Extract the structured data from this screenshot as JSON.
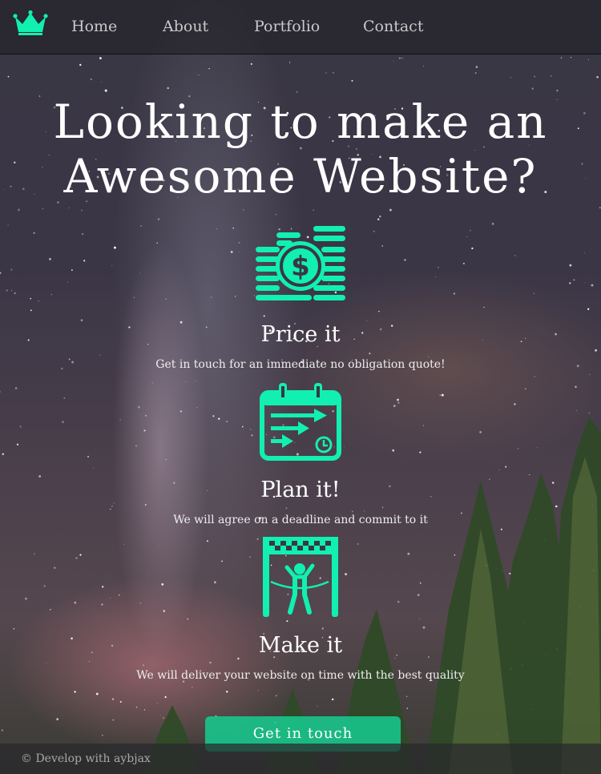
{
  "colors": {
    "accent": "#11f0b0",
    "button": "#16cd91",
    "nav_text": "#c9c9c9"
  },
  "nav": {
    "logo_icon": "crown-icon",
    "items": [
      {
        "label": "Home"
      },
      {
        "label": "About"
      },
      {
        "label": "Portfolio"
      },
      {
        "label": "Contact"
      }
    ]
  },
  "hero": {
    "title_line1": "Looking to make an",
    "title_line2": "Awesome Website?"
  },
  "steps": [
    {
      "icon": "coins-dollar-icon",
      "title": "Price it",
      "description": "Get in touch for an immediate no obligation quote!"
    },
    {
      "icon": "calendar-plan-icon",
      "title": "Plan it!",
      "description": "We will agree on a deadline and commit to it"
    },
    {
      "icon": "finish-line-icon",
      "title": "Make it",
      "description": "We will deliver your website on time with the best quality"
    }
  ],
  "cta": {
    "label": "Get in touch"
  },
  "footer": {
    "text": "© Develop with aybjax"
  }
}
